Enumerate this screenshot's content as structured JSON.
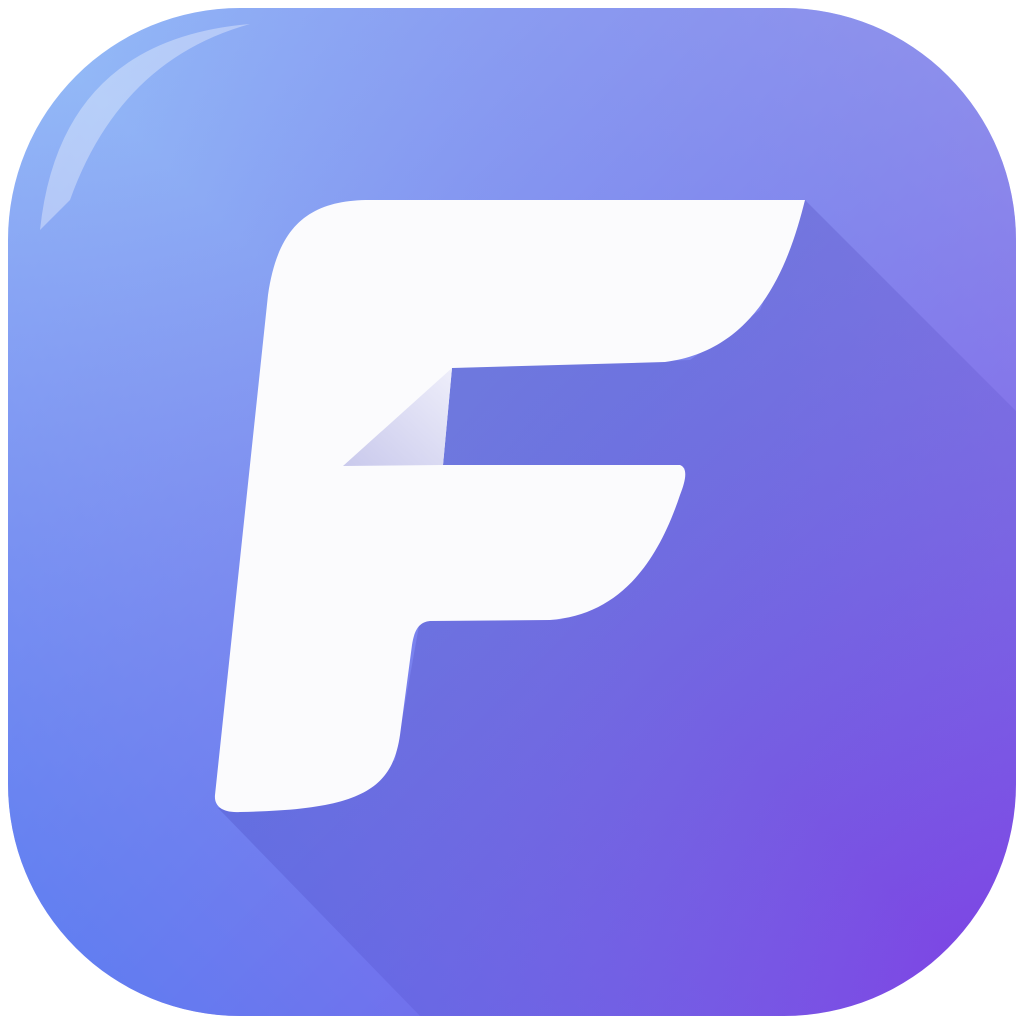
{
  "icon": {
    "name": "f-app-icon",
    "letter": "F",
    "colors": {
      "gradient_top_left": "#96c0f8",
      "gradient_top_right": "#9a98ea",
      "gradient_bottom_left": "#4f7af3",
      "gradient_bottom_right": "#7f3fe4",
      "glyph": "#fbfbfd",
      "glyph_fold": "#d7d7f0",
      "long_shadow": "#3a2bb0"
    }
  }
}
